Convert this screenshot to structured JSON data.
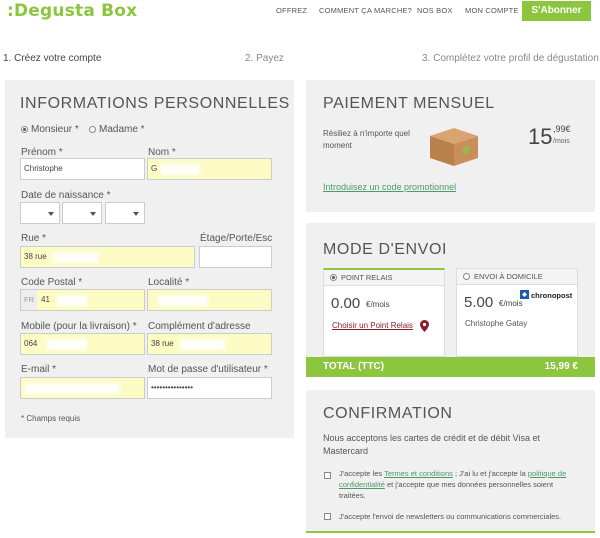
{
  "header": {
    "logo": ":Degusta Box",
    "nav": [
      "OFFREZ",
      "COMMENT ÇA MARCHE?",
      "NOS BOX",
      "MON COMPTE"
    ],
    "subscribe_label": "S'Abonner"
  },
  "steps": [
    "1. Créez votre compte",
    "2. Payez",
    "3. Complétez votre profil de dégustation"
  ],
  "personal": {
    "title": "INFORMATIONS PERSONNELLES",
    "civility": {
      "option1": "Monsieur *",
      "option2": "Madame *",
      "selected": "Monsieur *"
    },
    "firstname_label": "Prénom *",
    "firstname_value": "Christophe",
    "lastname_label": "Nom *",
    "lastname_value": "G",
    "birthdate_label": "Date de naissance *",
    "street_label": "Rue *",
    "street_value": "38 rue",
    "floor_label": "Étage/Porte/Esc",
    "postcode_label": "Code Postal *",
    "postcode_prefix": "FR",
    "postcode_value": "41",
    "city_label": "Localité *",
    "mobile_label": "Mobile (pour la livraison) *",
    "mobile_value": "064",
    "address2_label": "Complément d'adresse",
    "address2_value": "38 rue",
    "email_label": "E-mail *",
    "password_label": "Mot de passe d'utilisateur *",
    "password_value": "•••••••••••••••",
    "required_note": "* Champs requis"
  },
  "payment": {
    "title": "PAIEMENT MENSUEL",
    "note": "Résiliez à n'importe quel moment",
    "price_main": "15",
    "price_cents": ",99€",
    "price_unit": "/mois",
    "promo_link": "Introduisez un code promotionnel"
  },
  "shipping": {
    "title": "MODE D'ENVOI",
    "relay": {
      "label": "POINT RELAIS",
      "price": "0.00",
      "unit": "€/mois",
      "link": "Choisir un Point Relais"
    },
    "home": {
      "label": "ENVOI À DOMICILE",
      "price": "5.00",
      "unit": "€/mois",
      "carrier": "chronopost",
      "recipient": "Christophe Gatay"
    },
    "total_label": "TOTAL (TTC)",
    "total_value": "15,99 €"
  },
  "confirmation": {
    "title": "CONFIRMATION",
    "cards_note": "Nous acceptons les cartes de crédit et de débit Visa et Mastercard",
    "terms_pre": "J'accepte les ",
    "terms_link": "Termes et conditions",
    "terms_mid": " ; J'ai lu et j'accepte la ",
    "privacy_link": "politique de confidentialité",
    "terms_post": " et j'accepte que mes données personnelles soient traitées.",
    "newsletter": "J'accepte l'envoi de newsletters ou communications commerciales."
  },
  "colors": {
    "brand_green": "#8cc63f",
    "field_filled": "#fbfbc3",
    "panel_bg": "#f0f0f0"
  }
}
